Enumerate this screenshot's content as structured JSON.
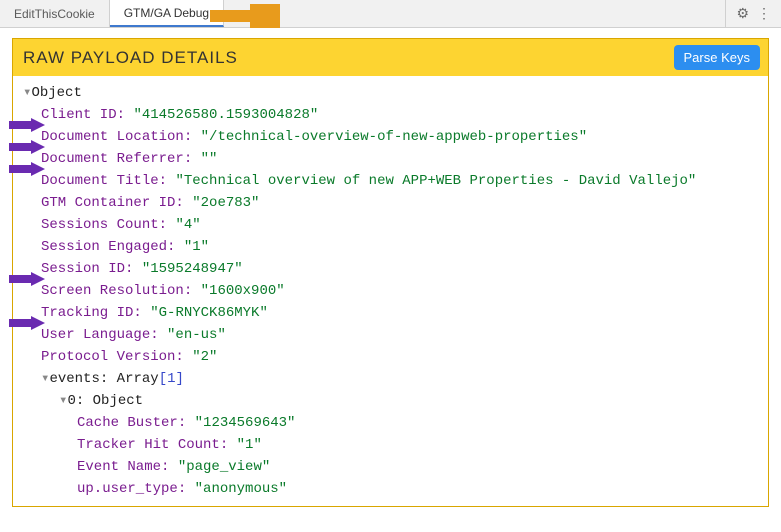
{
  "tabs": {
    "tab1": "EditThisCookie",
    "tab2": "GTM/GA Debug"
  },
  "panel": {
    "title": "RAW PAYLOAD DETAILS",
    "button": "Parse Keys"
  },
  "tree": {
    "root": "Object",
    "fields": [
      {
        "key": "Client ID",
        "val": "\"414526580.1593004828\""
      },
      {
        "key": "Document Location",
        "val": "\"/technical-overview-of-new-appweb-properties\""
      },
      {
        "key": "Document Referrer",
        "val": "\"\""
      },
      {
        "key": "Document Title",
        "val": "\"Technical overview of new APP+WEB Properties - David Vallejo\""
      },
      {
        "key": "GTM Container ID",
        "val": "\"2oe783\""
      },
      {
        "key": "Sessions Count",
        "val": "\"4\""
      },
      {
        "key": "Session Engaged",
        "val": "\"1\""
      },
      {
        "key": "Session ID",
        "val": "\"1595248947\""
      },
      {
        "key": "Screen Resolution",
        "val": "\"1600x900\""
      },
      {
        "key": "Tracking ID",
        "val": "\"G-RNYCK86MYK\""
      },
      {
        "key": "User Language",
        "val": "\"en-us\""
      },
      {
        "key": "Protocol Version",
        "val": "\"2\""
      }
    ],
    "eventsLabel": "events",
    "eventsType": "Array",
    "eventsLen": "[1]",
    "idx0": "0",
    "idx0Type": "Object",
    "evFields": [
      {
        "key": "Cache Buster",
        "val": "\"1234569643\""
      },
      {
        "key": "Tracker Hit Count",
        "val": "\"1\""
      },
      {
        "key": "Event Name",
        "val": "\"page_view\""
      },
      {
        "key": "up.user_type",
        "val": "\"anonymous\""
      }
    ]
  }
}
